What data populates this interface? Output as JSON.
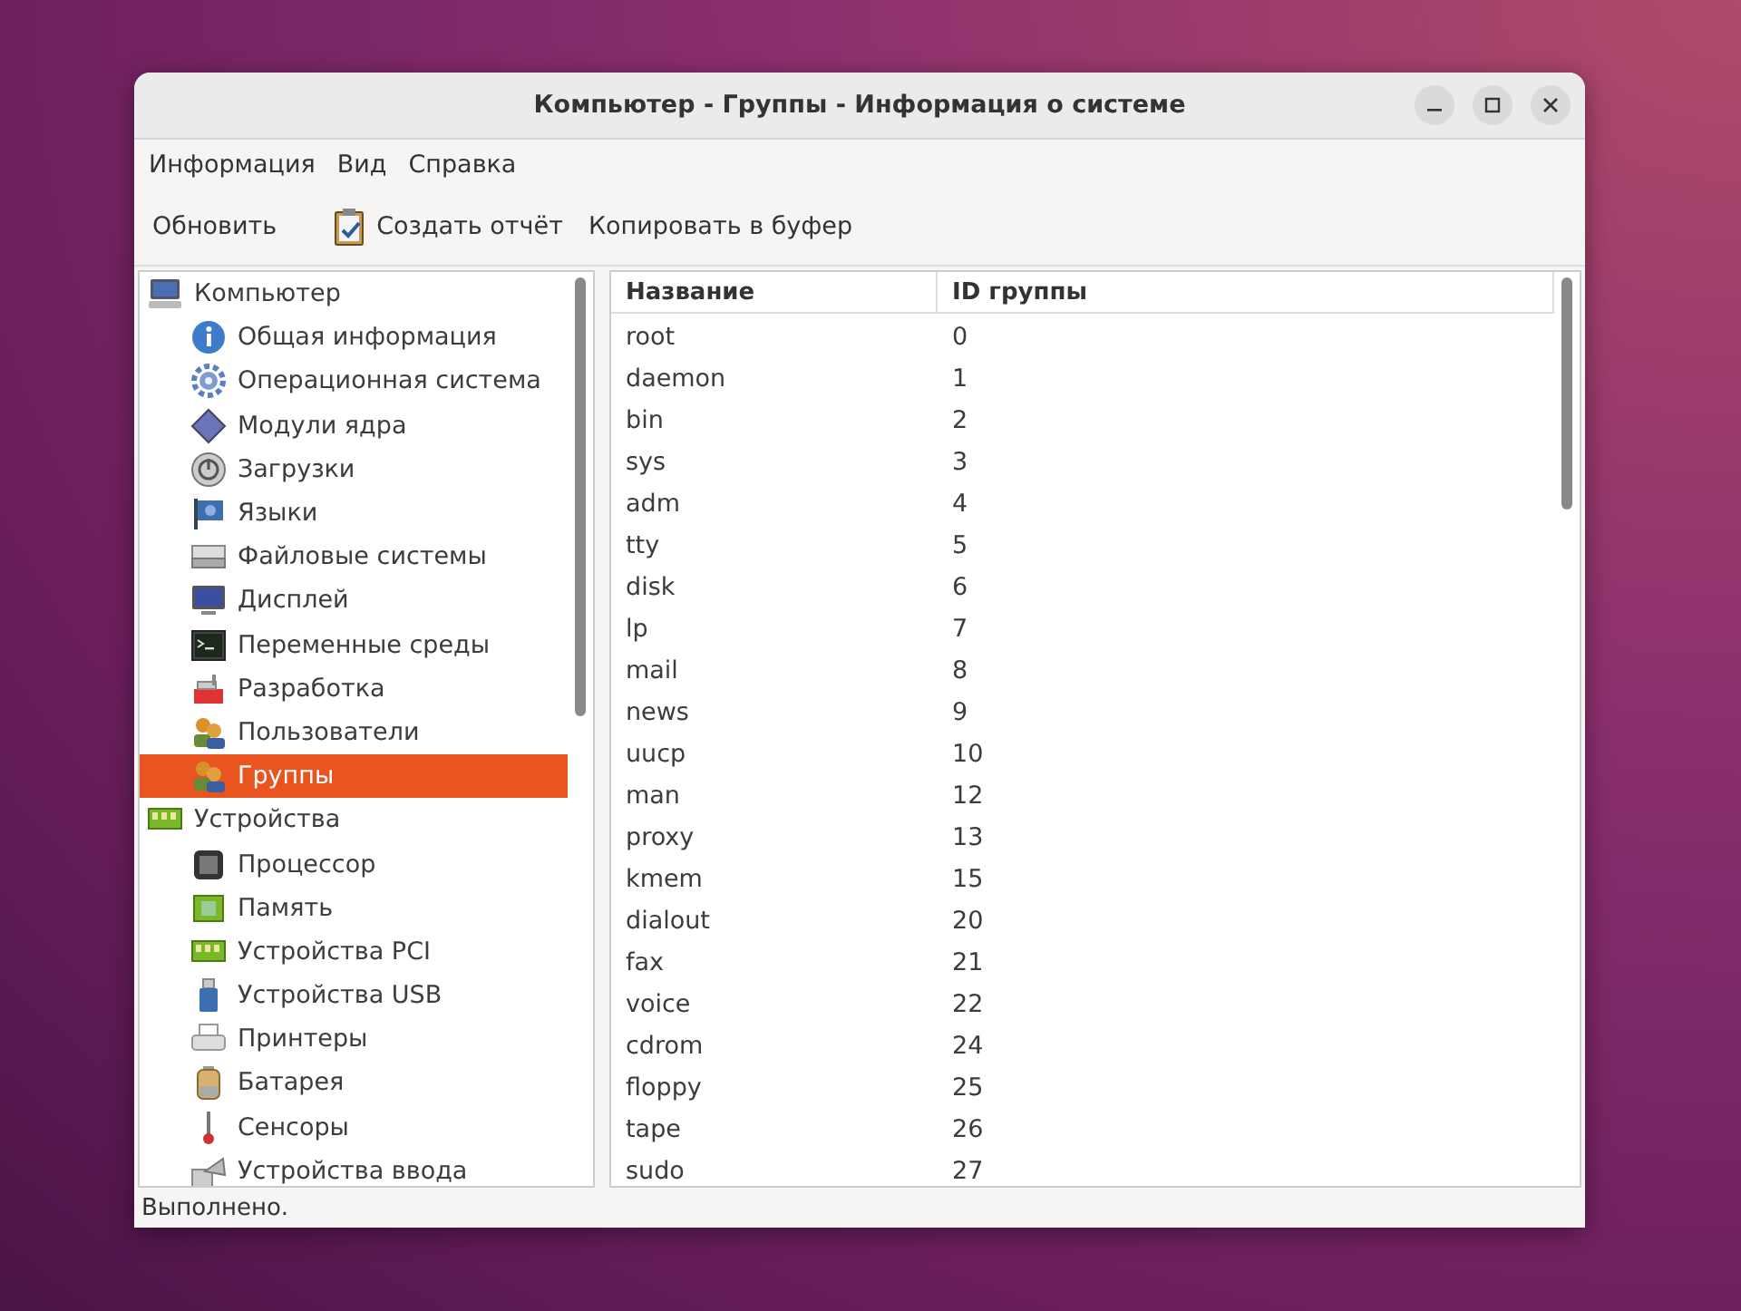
{
  "window": {
    "title": "Компьютер - Группы - Информация о системе"
  },
  "menu": [
    "Информация",
    "Вид",
    "Справка"
  ],
  "toolbar": [
    {
      "label": "Обновить",
      "kind": "plain"
    },
    {
      "label": "Создать отчёт",
      "kind": "report"
    },
    {
      "label": "Копировать в буфер",
      "kind": "plain"
    }
  ],
  "tree": [
    {
      "label": "Компьютер",
      "selected": false,
      "children": [
        {
          "label": "Общая информация",
          "selected": false
        },
        {
          "label": "Операционная система",
          "selected": false
        },
        {
          "label": "Модули ядра",
          "selected": false
        },
        {
          "label": "Загрузки",
          "selected": false
        },
        {
          "label": "Языки",
          "selected": false
        },
        {
          "label": "Файловые системы",
          "selected": false
        },
        {
          "label": "Дисплей",
          "selected": false
        },
        {
          "label": "Переменные среды",
          "selected": false
        },
        {
          "label": "Разработка",
          "selected": false
        },
        {
          "label": "Пользователи",
          "selected": false
        },
        {
          "label": "Группы",
          "selected": true
        }
      ]
    },
    {
      "label": "Устройства",
      "selected": false,
      "children": [
        {
          "label": "Процессор",
          "selected": false
        },
        {
          "label": "Память",
          "selected": false
        },
        {
          "label": "Устройства PCI",
          "selected": false
        },
        {
          "label": "Устройства USB",
          "selected": false
        },
        {
          "label": "Принтеры",
          "selected": false
        },
        {
          "label": "Батарея",
          "selected": false
        },
        {
          "label": "Сенсоры",
          "selected": false
        },
        {
          "label": "Устройства ввода",
          "selected": false
        }
      ]
    }
  ],
  "table": {
    "columns": [
      "Название",
      "ID группы"
    ],
    "rows": [
      [
        "root",
        "0"
      ],
      [
        "daemon",
        "1"
      ],
      [
        "bin",
        "2"
      ],
      [
        "sys",
        "3"
      ],
      [
        "adm",
        "4"
      ],
      [
        "tty",
        "5"
      ],
      [
        "disk",
        "6"
      ],
      [
        "lp",
        "7"
      ],
      [
        "mail",
        "8"
      ],
      [
        "news",
        "9"
      ],
      [
        "uucp",
        "10"
      ],
      [
        "man",
        "12"
      ],
      [
        "proxy",
        "13"
      ],
      [
        "kmem",
        "15"
      ],
      [
        "dialout",
        "20"
      ],
      [
        "fax",
        "21"
      ],
      [
        "voice",
        "22"
      ],
      [
        "cdrom",
        "24"
      ],
      [
        "floppy",
        "25"
      ],
      [
        "tape",
        "26"
      ],
      [
        "sudo",
        "27"
      ]
    ]
  },
  "status_bar": "Выполнено."
}
